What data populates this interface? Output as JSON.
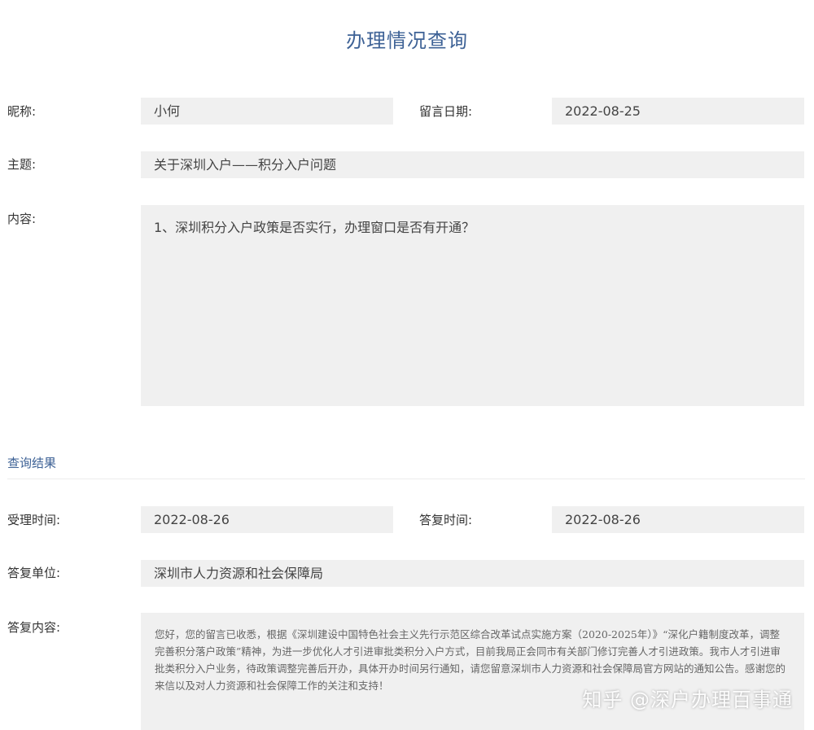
{
  "page_title": "办理情况查询",
  "message": {
    "nickname_label": "昵称:",
    "nickname": "小何",
    "date_label": "留言日期:",
    "date": "2022-08-25",
    "subject_label": "主题:",
    "subject": "关于深圳入户——积分入户问题",
    "content_label": "内容:",
    "content": "1、深圳积分入户政策是否实行，办理窗口是否有开通？"
  },
  "result": {
    "section_title": "查询结果",
    "accept_time_label": "受理时间:",
    "accept_time": "2022-08-26",
    "reply_time_label": "答复时间:",
    "reply_time": "2022-08-26",
    "reply_unit_label": "答复单位:",
    "reply_unit": "深圳市人力资源和社会保障局",
    "reply_content_label": "答复内容:",
    "reply_content": "您好，您的留言已收悉，根据《深圳建设中国特色社会主义先行示范区综合改革试点实施方案（2020-2025年）》“深化户籍制度改革，调整完善积分落户政策”精神，为进一步优化人才引进审批类积分入户方式，目前我局正会同市有关部门修订完善人才引进政策。我市人才引进审批类积分入户业务，待政策调整完善后开办，具体开办时间另行通知，请您留意深圳市人力资源和社会保障局官方网站的通知公告。感谢您的来信以及对人力资源和社会保障工作的关注和支持！"
  },
  "watermark": "知乎 @深户办理百事通",
  "colors": {
    "title_blue": "#3e6296",
    "field_bg": "#f0f0f0"
  }
}
